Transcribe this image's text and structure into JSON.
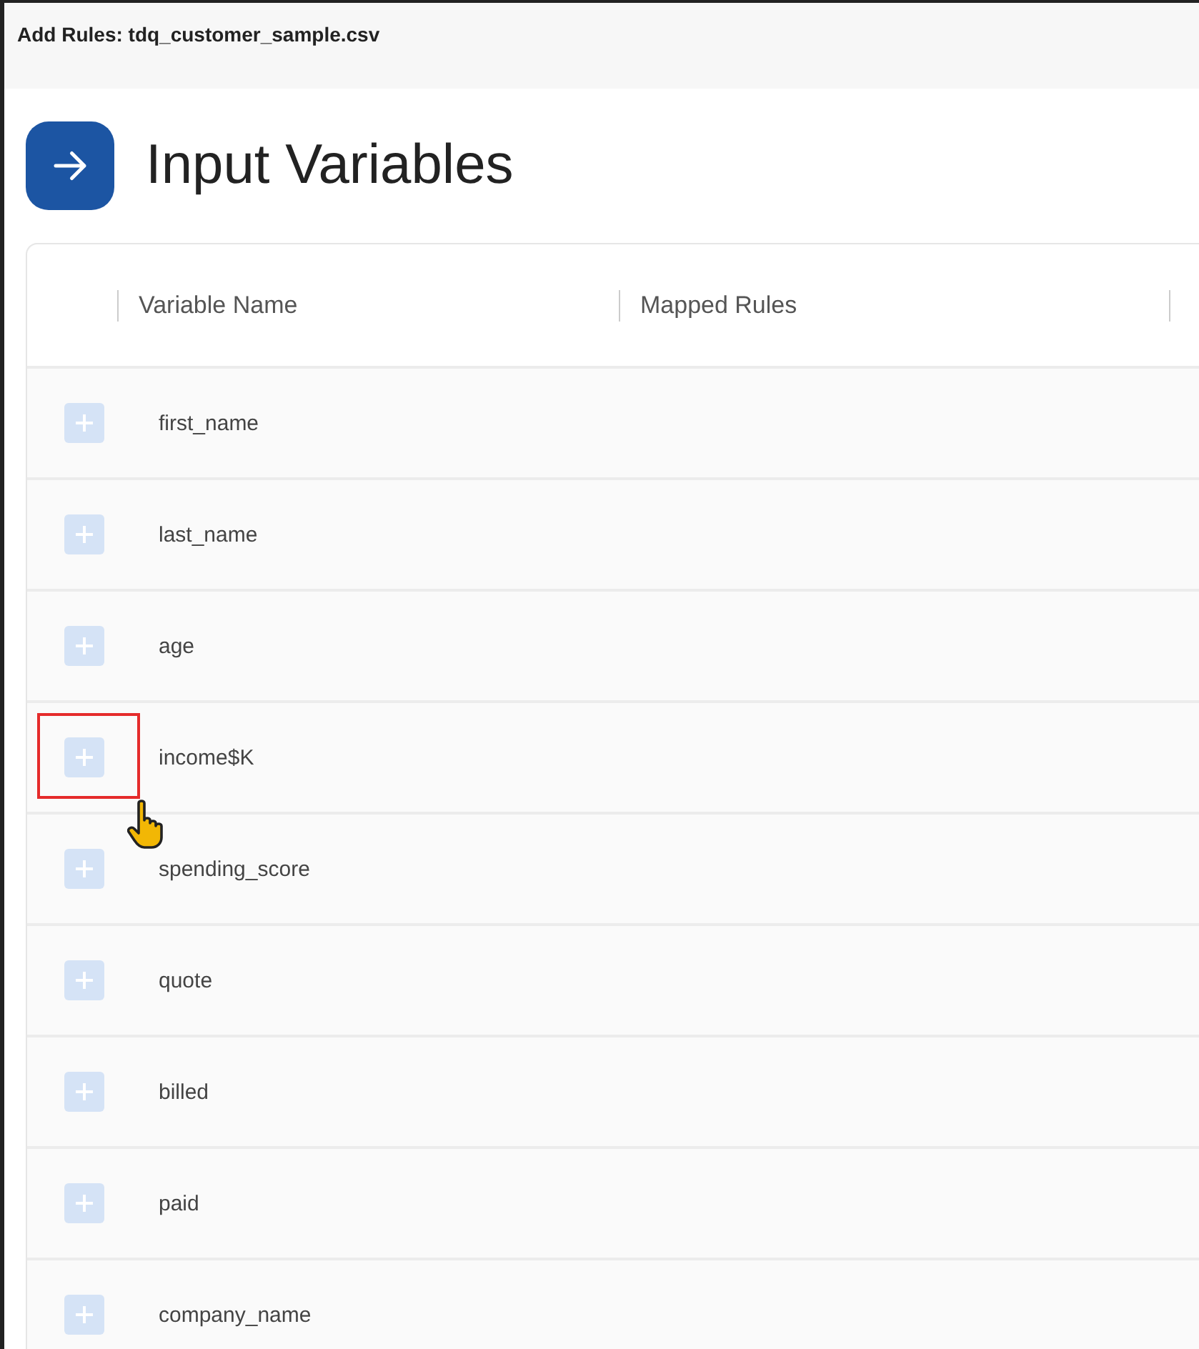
{
  "window": {
    "title": "Add Rules: tdq_customer_sample.csv"
  },
  "section": {
    "title": "Input Variables"
  },
  "table": {
    "columns": [
      "Variable Name",
      "Mapped Rules"
    ],
    "rows": [
      {
        "name": "first_name",
        "highlighted": false
      },
      {
        "name": "last_name",
        "highlighted": false
      },
      {
        "name": "age",
        "highlighted": false
      },
      {
        "name": "income$K",
        "highlighted": true
      },
      {
        "name": "spending_score",
        "highlighted": false
      },
      {
        "name": "quote",
        "highlighted": false
      },
      {
        "name": "billed",
        "highlighted": false
      },
      {
        "name": "paid",
        "highlighted": false
      },
      {
        "name": "company_name",
        "highlighted": false
      }
    ]
  }
}
